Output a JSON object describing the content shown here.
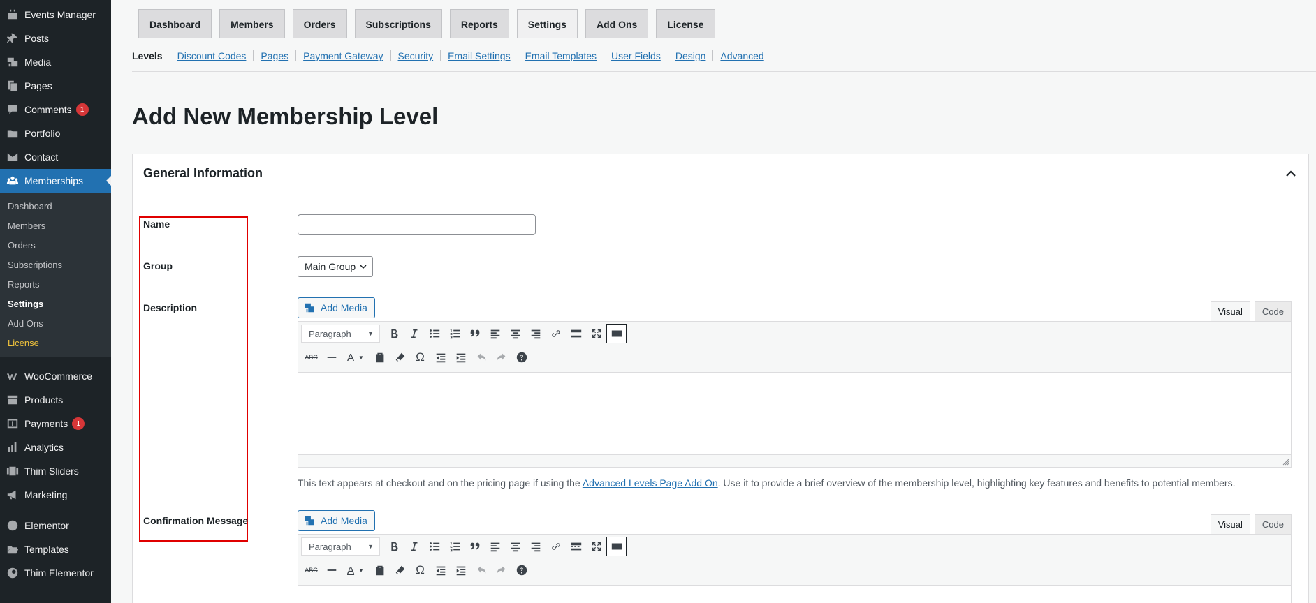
{
  "sidebar": {
    "items_top": [
      {
        "label": "Events Manager",
        "icon": "calendar-icon"
      },
      {
        "label": "Posts",
        "icon": "pin-icon"
      },
      {
        "label": "Media",
        "icon": "media-icon"
      },
      {
        "label": "Pages",
        "icon": "pages-icon"
      },
      {
        "label": "Comments",
        "icon": "comment-icon",
        "badge": "1"
      },
      {
        "label": "Portfolio",
        "icon": "folder-icon"
      },
      {
        "label": "Contact",
        "icon": "envelope-icon"
      }
    ],
    "active": {
      "label": "Memberships",
      "icon": "groups-icon"
    },
    "submenu": [
      "Dashboard",
      "Members",
      "Orders",
      "Subscriptions",
      "Reports",
      "Settings",
      "Add Ons",
      "License"
    ],
    "items_mid": [
      {
        "label": "WooCommerce",
        "icon": "woo-icon"
      },
      {
        "label": "Products",
        "icon": "archive-icon"
      },
      {
        "label": "Payments",
        "icon": "payments-icon",
        "badge": "1"
      },
      {
        "label": "Analytics",
        "icon": "chart-bar-icon"
      },
      {
        "label": "Thim Sliders",
        "icon": "slides-icon"
      },
      {
        "label": "Marketing",
        "icon": "megaphone-icon"
      }
    ],
    "items_bottom": [
      {
        "label": "Elementor",
        "icon": "elementor-icon"
      },
      {
        "label": "Templates",
        "icon": "folder-open-icon"
      },
      {
        "label": "Thim Elementor",
        "icon": "thim-icon"
      }
    ]
  },
  "tabs": [
    "Dashboard",
    "Members",
    "Orders",
    "Subscriptions",
    "Reports",
    "Settings",
    "Add Ons",
    "License"
  ],
  "subnav": {
    "current": "Levels",
    "links": [
      "Discount Codes",
      "Pages",
      "Payment Gateway",
      "Security",
      "Email Settings",
      "Email Templates",
      "User Fields",
      "Design",
      "Advanced"
    ]
  },
  "page": {
    "title": "Add New Membership Level"
  },
  "panel": {
    "title": "General Information",
    "labels": {
      "name": "Name",
      "group": "Group",
      "description": "Description",
      "confirmation": "Confirmation Message"
    },
    "name_value": "",
    "group_selected": "Main Group",
    "editor": {
      "add_media": "Add Media",
      "format": "Paragraph",
      "mode_visual": "Visual",
      "mode_code": "Code"
    },
    "help_prefix": "This text appears at checkout and on the pricing page if using the ",
    "help_link": "Advanced Levels Page Add On",
    "help_suffix": ". Use it to provide a brief overview of the membership level, highlighting key features and benefits to potential members."
  },
  "colors": {
    "accent": "#2271b1",
    "sidebar": "#1d2327",
    "badge": "#d63638",
    "highlight_outline": "#e00000"
  }
}
